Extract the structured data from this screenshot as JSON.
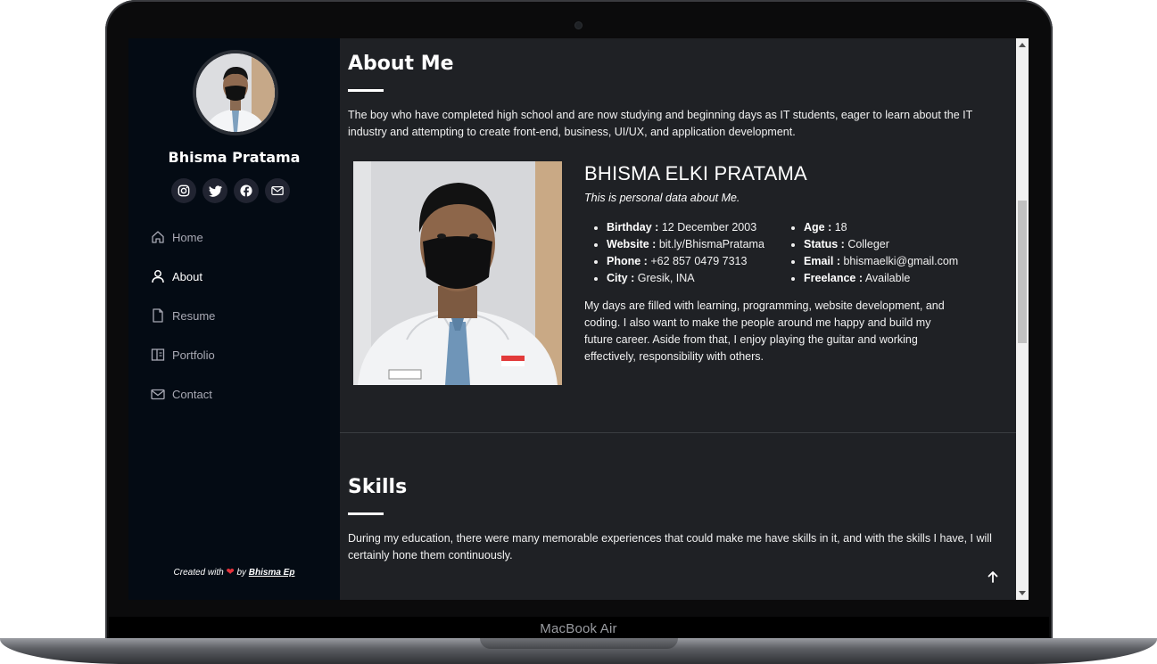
{
  "device": {
    "brand": "MacBook Air"
  },
  "sidebar": {
    "name": "Bhisma Pratama",
    "socials": [
      "instagram-icon",
      "twitter-icon",
      "facebook-icon",
      "mail-icon"
    ],
    "nav": [
      {
        "label": "Home",
        "icon": "home-icon"
      },
      {
        "label": "About",
        "icon": "user-icon",
        "active": true
      },
      {
        "label": "Resume",
        "icon": "file-icon"
      },
      {
        "label": "Portfolio",
        "icon": "portfolio-icon"
      },
      {
        "label": "Contact",
        "icon": "envelope-icon"
      }
    ],
    "credit": {
      "prefix": "Created with",
      "by": "by",
      "author": "Bhisma Ep"
    }
  },
  "about": {
    "title": "About Me",
    "intro": "The boy who have completed high school and are now studying and beginning days as IT students, eager to learn about the IT industry and attempting to create front-end, business, UI/UX, and application development.",
    "full_name": "BHISMA ELKI PRATAMA",
    "tagline": "This is personal data about Me.",
    "left_facts": [
      {
        "label": "Birthday :",
        "value": "12 December 2003"
      },
      {
        "label": "Website :",
        "value": "bit.ly/BhismaPratama"
      },
      {
        "label": "Phone :",
        "value": "+62 857 0479 7313"
      },
      {
        "label": "City :",
        "value": "Gresik, INA"
      }
    ],
    "right_facts": [
      {
        "label": "Age :",
        "value": "18"
      },
      {
        "label": "Status :",
        "value": "Colleger"
      },
      {
        "label": "Email :",
        "value": "bhismaelki@gmail.com"
      },
      {
        "label": "Freelance :",
        "value": "Available"
      }
    ],
    "bio": "My days are filled with learning, programming, website development, and coding. I also want to make the people around me happy and build my future career. Aside from that, I enjoy playing the guitar and working effectively, responsibility with others."
  },
  "skills": {
    "title": "Skills",
    "intro": "During my education, there were many memorable experiences that could make me have skills in it, and with the skills I have, I will certainly hone them continuously."
  },
  "colors": {
    "sidebar_bg": "#040b14",
    "main_bg": "#1f2125",
    "accent_heart": "#e5323b"
  }
}
